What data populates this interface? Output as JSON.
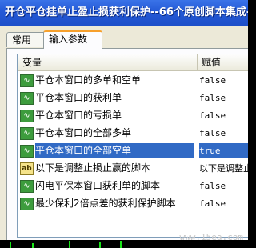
{
  "window": {
    "title": "开仓平仓挂单止盈止损获利保护--66个原创脚本集成--"
  },
  "tabs": [
    {
      "label": "常用"
    },
    {
      "label": "输入参数"
    }
  ],
  "table": {
    "headers": {
      "variable": "变量",
      "value": "赋值"
    },
    "rows": [
      {
        "icon": "chart-icon",
        "name": "平仓本窗口的多单和空单",
        "value": "false",
        "selected": false
      },
      {
        "icon": "chart-icon",
        "name": "平仓本窗口的获利单",
        "value": "false",
        "selected": false
      },
      {
        "icon": "chart-icon",
        "name": "平仓本窗口的亏损单",
        "value": "false",
        "selected": false
      },
      {
        "icon": "chart-icon",
        "name": "平仓本窗口的全部多单",
        "value": "false",
        "selected": false
      },
      {
        "icon": "chart-icon",
        "name": "平仓本窗口的全部空单",
        "value": "true",
        "selected": true
      },
      {
        "icon": "text-ab-icon",
        "name": "以下是调整止损止赢的脚本",
        "value": "以下是调整止",
        "selected": false
      },
      {
        "icon": "chart-icon",
        "name": "闪电平保本窗口获利单的脚本",
        "value": "false",
        "selected": false
      },
      {
        "icon": "chart-icon",
        "name": "最少保利2倍点差的获利保护脚本",
        "value": "false",
        "selected": false
      }
    ]
  },
  "watermark": "www.15ea.com"
}
